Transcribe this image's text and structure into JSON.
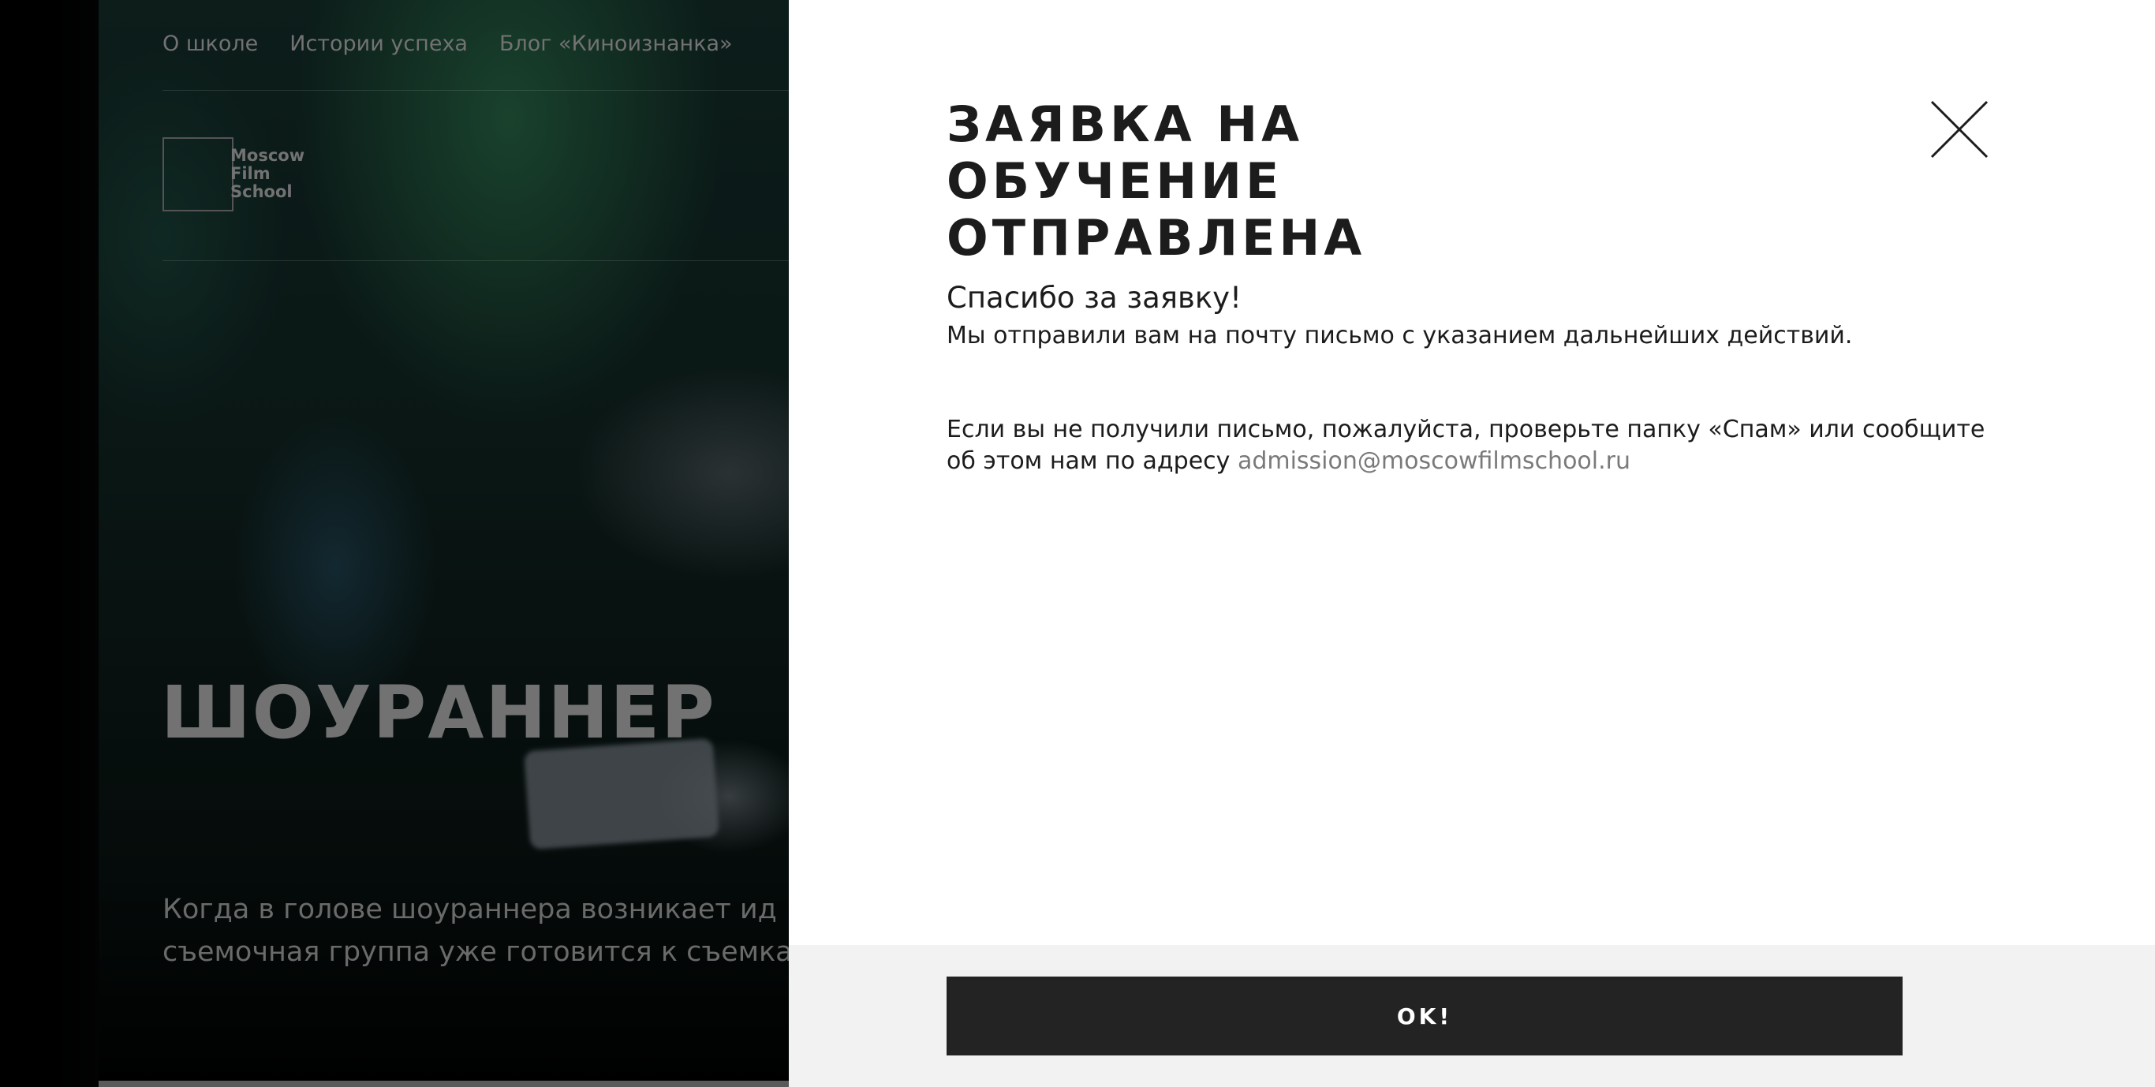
{
  "background_page": {
    "nav": [
      {
        "label": "О школе"
      },
      {
        "label": "Истории успеха"
      },
      {
        "label": "Блог «Киноизнанка»"
      }
    ],
    "logo": {
      "line1": "Moscow",
      "line2": "Film",
      "line3": "School"
    },
    "course_title": "ШОУРАННЕР",
    "course_description": {
      "line1": "Когда в голове шоураннера возникает ид",
      "line2": "съемочная группа уже готовится к съемка"
    }
  },
  "modal": {
    "title": "ЗАЯВКА НА ОБУЧЕНИЕ ОТПРАВЛЕНА",
    "close_icon": "close-icon",
    "thanks": "Спасибо за заявку!",
    "sent_message": "Мы отправили вам на почту письмо с указанием дальнейших действий.",
    "spam_message": "Если вы не получили письмо, пожалуйста, проверьте папку «Спам» или сообщите об этом нам по адресу",
    "email": "admission@moscowfilmschool.ru",
    "ok_button": "OK!"
  },
  "colors": {
    "modal_background": "#ffffff",
    "footer_background": "#f2f2f2",
    "button_background": "#232323",
    "button_text": "#ffffff",
    "link_color": "#7a7a7a",
    "text_color": "#1c1c1c"
  }
}
